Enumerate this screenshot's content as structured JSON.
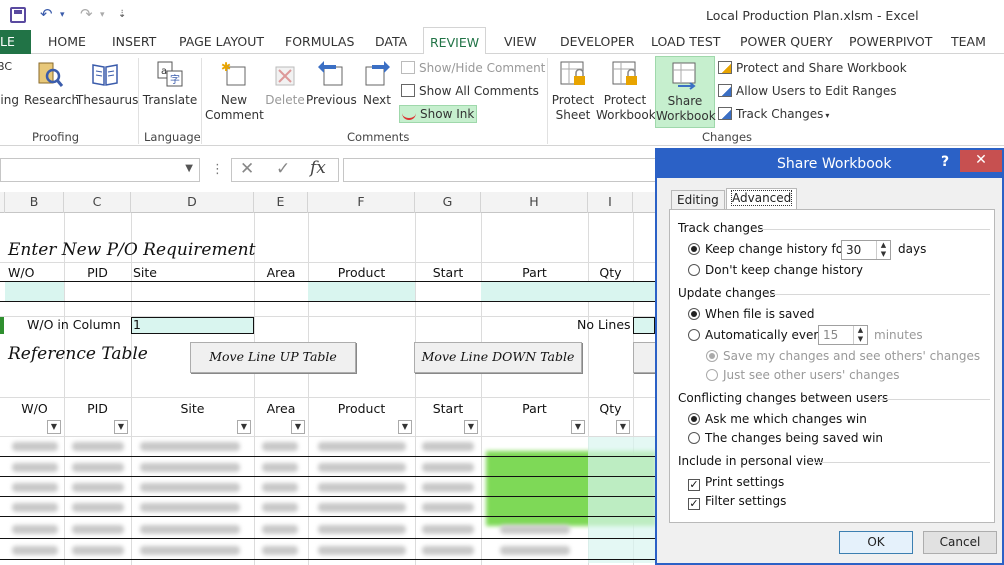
{
  "window": {
    "title": "Local Production Plan.xlsm - Excel"
  },
  "ribbon_tabs": [
    "LE",
    "HOME",
    "INSERT",
    "PAGE LAYOUT",
    "FORMULAS",
    "DATA",
    "REVIEW",
    "VIEW",
    "DEVELOPER",
    "LOAD TEST",
    "POWER QUERY",
    "POWERPIVOT",
    "TEAM"
  ],
  "ribbon": {
    "spelling": "ling",
    "spelling_abc": "BC",
    "research": "Research",
    "thesaurus": "Thesaurus",
    "proofing": "Proofing",
    "translate": "Translate",
    "language": "Language",
    "new_comment_1": "New",
    "new_comment_2": "Comment",
    "delete": "Delete",
    "previous": "Previous",
    "next": "Next",
    "show_hide_comment": "Show/Hide Comment",
    "show_all_comments": "Show All Comments",
    "show_ink": "Show Ink",
    "comments": "Comments",
    "protect_sheet_1": "Protect",
    "protect_sheet_2": "Sheet",
    "protect_workbook_1": "Protect",
    "protect_workbook_2": "Workbook",
    "share_workbook_1": "Share",
    "share_workbook_2": "Workbook",
    "protect_share": "Protect and Share Workbook",
    "allow_users": "Allow Users to Edit Ranges",
    "track_changes": "Track Changes",
    "changes": "Changes"
  },
  "formula_bar": {
    "fx": "fx"
  },
  "columns": [
    "B",
    "C",
    "D",
    "E",
    "F",
    "G",
    "H",
    "I"
  ],
  "sheet": {
    "title1": "Enter New P/O Requirement",
    "h1": [
      "W/O",
      "PID",
      "Site",
      "Area",
      "Product",
      "Start",
      "Part",
      "Qty"
    ],
    "wo_in_column": "W/O in Column",
    "wo_value": "1",
    "no_lines": "No Lines",
    "title2": "Reference Table",
    "move_up": "Move Line UP Table",
    "move_down": "Move Line DOWN Table",
    "h2": [
      "W/O",
      "PID",
      "Site",
      "Area",
      "Product",
      "Start",
      "Part",
      "Qty"
    ]
  },
  "dialog": {
    "title": "Share Workbook",
    "help": "?",
    "close": "✕",
    "tab_editing": "Editing",
    "tab_advanced": "Advanced",
    "track_changes": "Track changes",
    "keep_history": "Keep change history for:",
    "keep_days_value": "30",
    "days": "days",
    "dont_keep": "Don't keep change history",
    "update_changes": "Update changes",
    "when_saved": "When file is saved",
    "auto_every": "Automatically every:",
    "auto_value": "15",
    "minutes": "minutes",
    "save_mine": "Save my changes and see others' changes",
    "just_see": "Just see other users' changes",
    "conflicting": "Conflicting changes between users",
    "ask_me": "Ask me which changes win",
    "changes_saved": "The changes being saved win",
    "personal_view": "Include in personal view",
    "print_settings": "Print settings",
    "filter_settings": "Filter settings",
    "ok": "OK",
    "cancel": "Cancel"
  },
  "colors": {
    "excel_green": "#217346",
    "dialog_blue": "#2b61c6",
    "cell_fill": "#d9f5ef",
    "highlight": "#c6efce"
  }
}
